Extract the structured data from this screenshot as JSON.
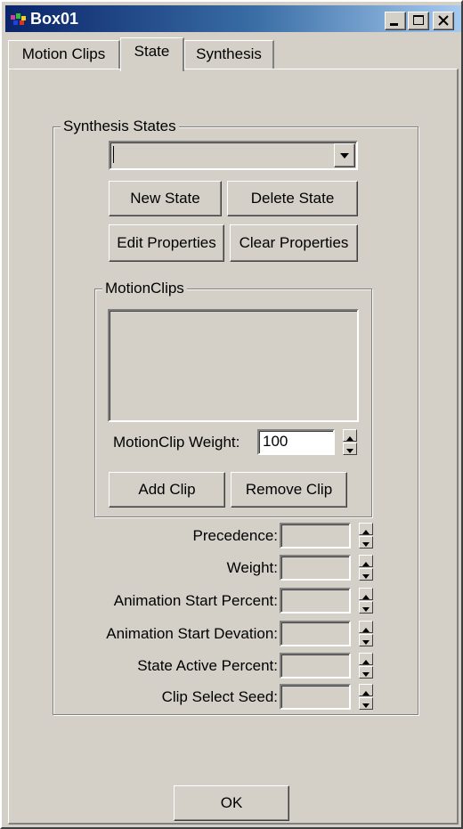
{
  "window": {
    "title": "Box01"
  },
  "tabs": [
    {
      "label": "Motion Clips"
    },
    {
      "label": "State"
    },
    {
      "label": "Synthesis"
    }
  ],
  "synthesis_states": {
    "group_label": "Synthesis States",
    "dropdown_value": "",
    "buttons": {
      "new_state": "New State",
      "delete_state": "Delete State",
      "edit_properties": "Edit Properties",
      "clear_properties": "Clear Properties"
    }
  },
  "motion_clips": {
    "group_label": "MotionClips",
    "weight_label": "MotionClip Weight:",
    "weight_value": "100",
    "buttons": {
      "add_clip": "Add Clip",
      "remove_clip": "Remove Clip"
    }
  },
  "properties": [
    {
      "label": "Precedence:",
      "value": ""
    },
    {
      "label": "Weight:",
      "value": ""
    },
    {
      "label": "Animation Start Percent:",
      "value": ""
    },
    {
      "label": "Animation Start Devation:",
      "value": ""
    },
    {
      "label": "State Active Percent:",
      "value": ""
    },
    {
      "label": "Clip Select Seed:",
      "value": ""
    }
  ],
  "ok_label": "OK"
}
